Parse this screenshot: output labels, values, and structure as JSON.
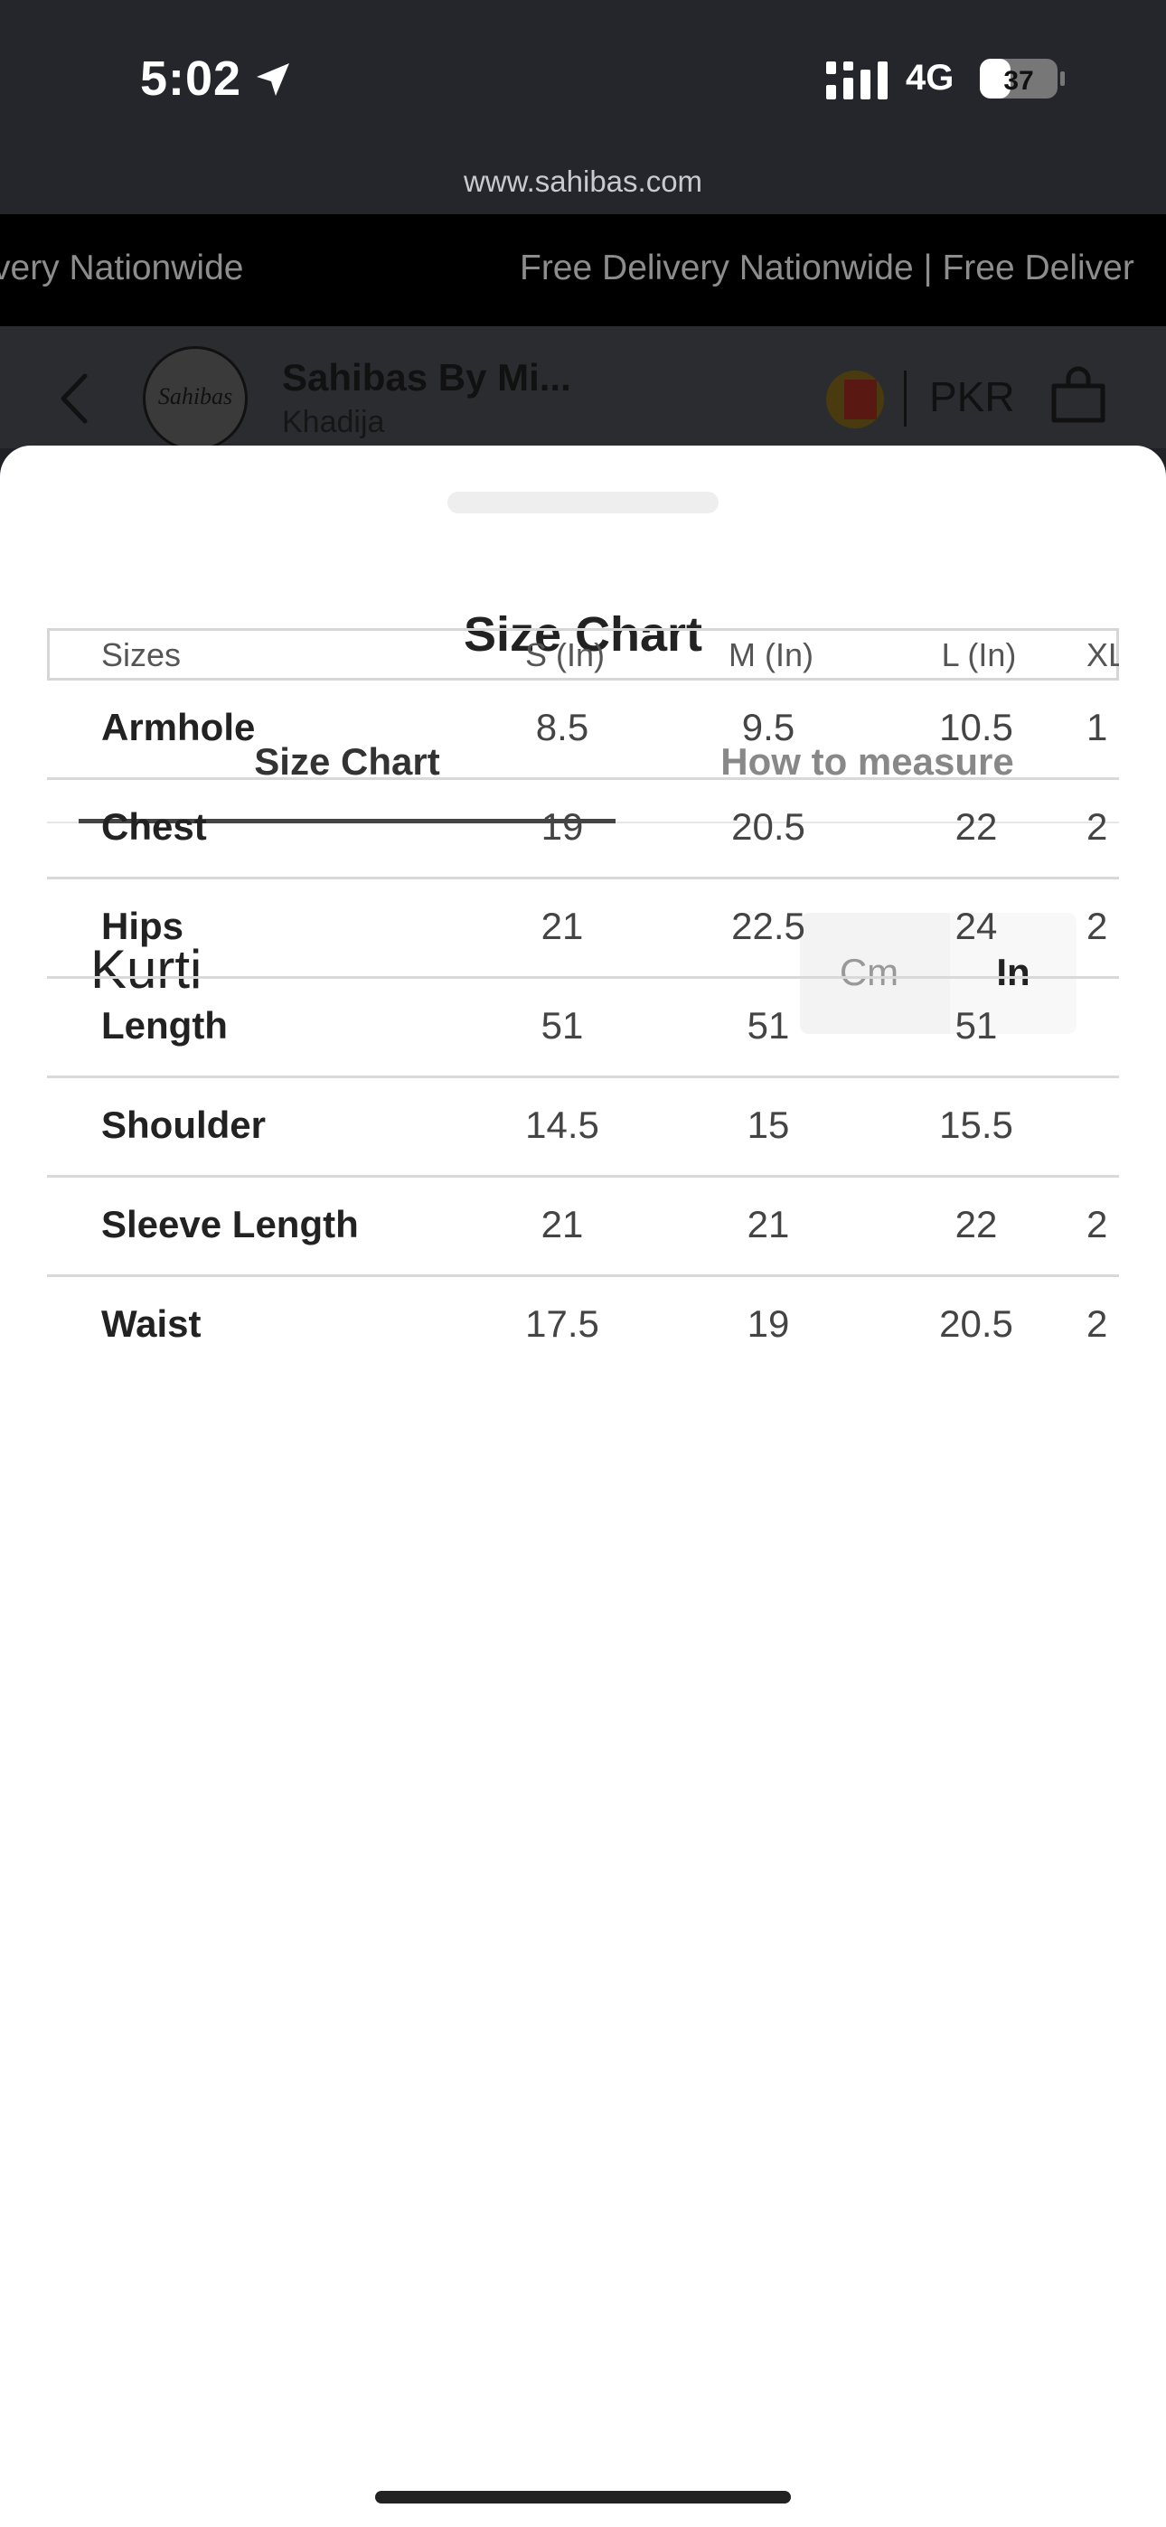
{
  "status_bar": {
    "time": "5:02",
    "network": "4G",
    "battery": "37"
  },
  "browser": {
    "url": "www.sahibas.com"
  },
  "marquee": {
    "items": [
      "very Nationwide",
      "Free Delivery Nationwide | Free Deliver"
    ]
  },
  "header": {
    "logo_text": "Sahibas",
    "store_name": "Sahibas By Mi...",
    "store_sub": "Khadija",
    "currency": "PKR"
  },
  "sheet": {
    "title": "Size Chart",
    "tabs": [
      {
        "label": "Size Chart",
        "active": true
      },
      {
        "label": "How to measure",
        "active": false
      }
    ],
    "section_title": "Kurti",
    "unit_toggle": {
      "options": [
        "Cm",
        "In"
      ],
      "selected": "In"
    }
  },
  "table": {
    "headers": [
      "Sizes",
      "S (In)",
      "M (In)",
      "L (In)",
      "XL"
    ],
    "rows": [
      {
        "name": "Armhole",
        "s": "8.5",
        "m": "9.5",
        "l": "10.5",
        "xl": "1"
      },
      {
        "name": "Chest",
        "s": "19",
        "m": "20.5",
        "l": "22",
        "xl": "2"
      },
      {
        "name": "Hips",
        "s": "21",
        "m": "22.5",
        "l": "24",
        "xl": "2"
      },
      {
        "name": "Length",
        "s": "51",
        "m": "51",
        "l": "51",
        "xl": ""
      },
      {
        "name": "Shoulder",
        "s": "14.5",
        "m": "15",
        "l": "15.5",
        "xl": ""
      },
      {
        "name": "Sleeve Length",
        "s": "21",
        "m": "21",
        "l": "22",
        "xl": "2"
      },
      {
        "name": "Waist",
        "s": "17.5",
        "m": "19",
        "l": "20.5",
        "xl": "2"
      }
    ]
  },
  "colors": {
    "status_bg": "#24262c",
    "marquee_bg": "#000000",
    "sheet_bg": "#ffffff",
    "accent": "#444444"
  }
}
